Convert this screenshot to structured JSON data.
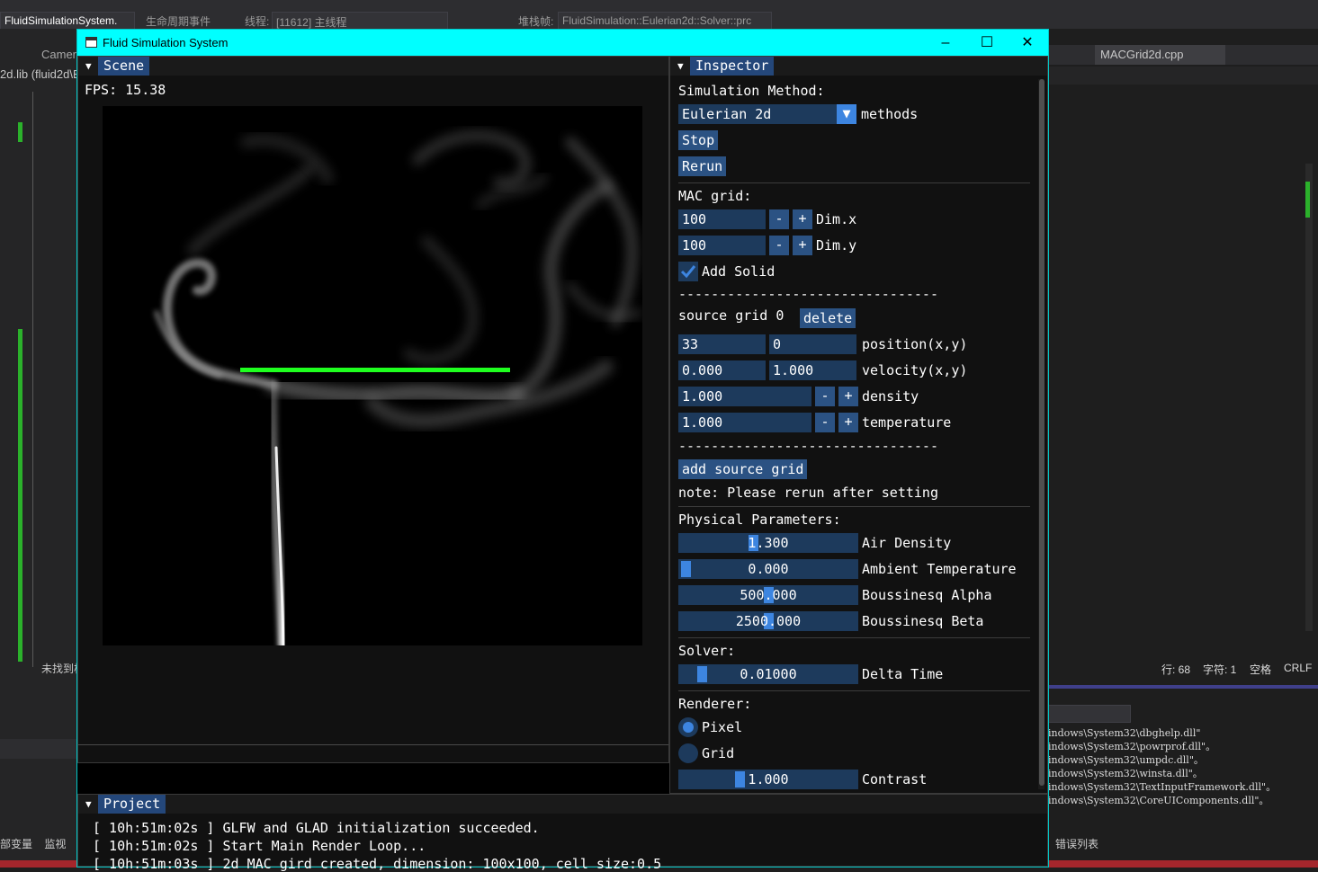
{
  "ide": {
    "top_selectors": [
      "FluidSimulationSystem.",
      "生命周期事件",
      "线程:",
      "[11612] 主线程",
      "堆栈帧:",
      "FluidSimulation::Eulerian2d::Solver::prc"
    ],
    "left_tabs": [
      "Camer",
      "2d.lib (fluid2d\\E"
    ],
    "right_tab": "MACGrid2d.cpp",
    "status_line": "行: 68",
    "status_char": "字符: 1",
    "status_space": "空格",
    "status_crlf": "CRLF",
    "left_status": "未找到相",
    "bottom_left_tabs": [
      "部变量",
      "监视"
    ],
    "bottom_right_tab": "错误列表",
    "output_lines": [
      "indows\\System32\\dbghelp.dll\"",
      "indows\\System32\\powrprof.dll\"。",
      "indows\\System32\\umpdc.dll\"。",
      "indows\\System32\\winsta.dll\"。",
      "indows\\System32\\TextInputFramework.dll\"。",
      "indows\\System32\\CoreUIComponents.dll\"。"
    ]
  },
  "window": {
    "title": "Fluid Simulation System",
    "titlebar_color": "#00ffff"
  },
  "scene": {
    "header": "Scene",
    "fps_label": "FPS: 15.38"
  },
  "inspector": {
    "header": "Inspector",
    "sim_method_label": "Simulation Method:",
    "method_value": "Eulerian 2d",
    "methods_label": "methods",
    "stop": "Stop",
    "rerun": "Rerun",
    "mac_grid_label": "MAC grid:",
    "dim_x_value": "100",
    "dim_x_label": "Dim.x",
    "dim_y_value": "100",
    "dim_y_label": "Dim.y",
    "minus": "-",
    "plus": "+",
    "add_solid_label": "Add Solid",
    "add_solid_checked": true,
    "separator": "--------------------------------",
    "source_grid_label": "source grid 0",
    "delete": "delete",
    "pos_x": "33",
    "pos_y": "0",
    "position_label": "position(x,y)",
    "vel_x": "0.000",
    "vel_y": "1.000",
    "velocity_label": "velocity(x,y)",
    "density_value": "1.000",
    "density_label": "density",
    "temperature_value": "1.000",
    "temperature_label": "temperature",
    "add_source": "add source grid",
    "note": "note: Please rerun after setting",
    "physical_label": "Physical Parameters:",
    "air_density_value": "1.300",
    "air_density_label": "Air Density",
    "ambient_temp_value": "0.000",
    "ambient_temp_label": "Ambient Temperature",
    "alpha_value": "500.000",
    "alpha_label": "Boussinesq Alpha",
    "beta_value": "2500.000",
    "beta_label": "Boussinesq Beta",
    "solver_label": "Solver:",
    "delta_time_value": "0.01000",
    "delta_time_label": "Delta Time",
    "renderer_label": "Renderer:",
    "pixel_label": "Pixel",
    "grid_label": "Grid",
    "renderer_selected": "Pixel",
    "contrast_value": "1.000",
    "contrast_label": "Contrast"
  },
  "project": {
    "header": "Project",
    "log": [
      "[ 10h:51m:02s ] GLFW and GLAD initialization succeeded.",
      "[ 10h:51m:02s ] Start Main Render Loop...",
      "[ 10h:51m:03s ] 2d MAC gird created, dimension: 100x100, cell size:0.5"
    ]
  }
}
